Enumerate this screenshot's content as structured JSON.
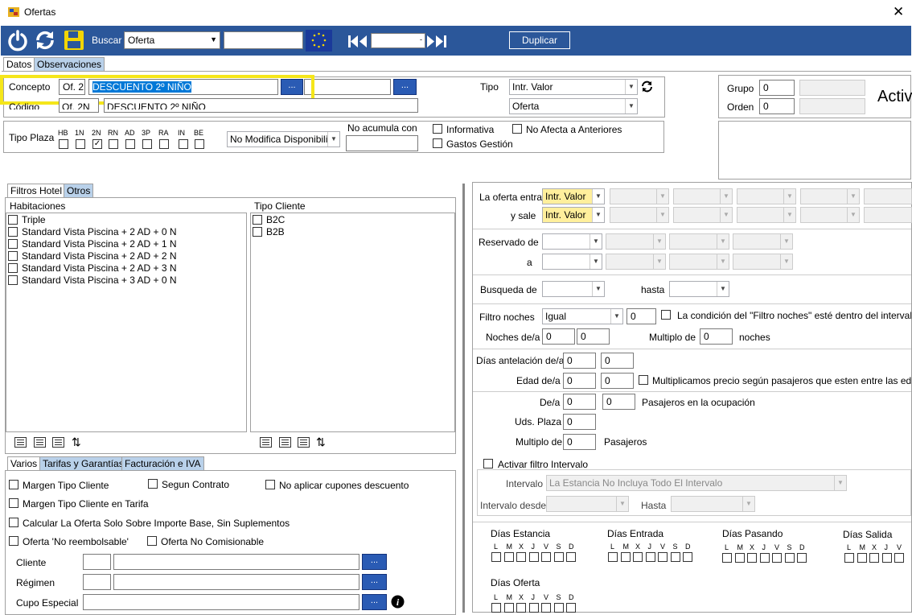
{
  "window": {
    "title": "Ofertas",
    "close": "✕"
  },
  "toolbar": {
    "buscar_label": "Buscar",
    "buscar_value": "Oferta",
    "duplicar": "Duplicar"
  },
  "tabs_main": [
    "Datos",
    "Observaciones"
  ],
  "concepto": {
    "label": "Concepto",
    "code": "Of. 2",
    "value": "DESCUENTO 2º NIÑO"
  },
  "codigo": {
    "label": "Código",
    "code": "Of. 2N",
    "value": "DESCUENTO 2º NIÑO"
  },
  "tipo": {
    "label": "Tipo",
    "value1": "Intr. Valor",
    "value2": "Oferta"
  },
  "grupo": {
    "label": "Grupo",
    "value": "0"
  },
  "orden": {
    "label": "Orden",
    "value": "0"
  },
  "activa_label": "Activ",
  "tipo_plaza": {
    "label": "Tipo Plaza",
    "codes": [
      "HB",
      "1N",
      "2N",
      "RN",
      "AD",
      "3P",
      "RA",
      "IN",
      "BE"
    ],
    "checked": [
      false,
      false,
      true,
      false,
      false,
      false,
      false,
      false,
      false
    ]
  },
  "modifica": "No Modifica Disponibilid",
  "no_acumula": "No acumula con",
  "informativa": "Informativa",
  "gastos": "Gastos Gestión",
  "no_afecta": "No Afecta a Anteriores",
  "filter_tabs": [
    "Filtros Hotel",
    "Otros"
  ],
  "habitaciones": {
    "header": "Habitaciones",
    "items": [
      "Triple",
      "Standard Vista Piscina + 2 AD + 0 N",
      "Standard Vista Piscina + 2 AD + 1 N",
      "Standard Vista Piscina + 2 AD + 2 N",
      "Standard Vista Piscina + 2 AD + 3 N",
      "Standard Vista Piscina + 3 AD + 0 N"
    ]
  },
  "tipo_cliente": {
    "header": "Tipo Cliente",
    "items": [
      "B2C",
      "B2B"
    ]
  },
  "bottom_tabs": [
    "Varios",
    "Tarifas y Garantías",
    "Facturación e IVA"
  ],
  "varios": {
    "margen_cliente": "Margen Tipo Cliente",
    "segun_contrato": "Segun Contrato",
    "no_cupones": "No aplicar cupones descuento",
    "margen_tarifa": "Margen Tipo Cliente  en Tarifa",
    "calcular": "Calcular La Oferta Solo Sobre Importe Base, Sin Suplementos",
    "no_reembolsable": "Oferta 'No reembolsable'",
    "no_comisionable": "Oferta No Comisionable",
    "cliente": "Cliente",
    "regimen": "Régimen",
    "cupo": "Cupo Especial",
    "dots": "..."
  },
  "right": {
    "oferta_entra": "La oferta entra",
    "y_sale": "y sale",
    "intr_valor": "Intr. Valor",
    "reservado_de": "Reservado de",
    "a": "a",
    "busqueda_de": "Busqueda de",
    "hasta": "hasta",
    "filtro_noches": "Filtro noches",
    "igual": "Igual",
    "zero": "0",
    "condicion": "La condición del \"Filtro noches\" esté dentro del intervalo de la",
    "noches_dea": "Noches de/a",
    "multiplo_de": "Multiplo de",
    "noches": "noches",
    "dias_antelacion": "Días antelación de/a",
    "edad_dea": "Edad de/a",
    "multiplicamos": "Multiplicamos precio según pasajeros que esten entre las edades ind",
    "dea": "De/a",
    "pasajeros_ocupacion": "Pasajeros en la ocupación",
    "uds_plaza": "Uds. Plaza",
    "multiplo_de2": "Multiplo de",
    "pasajeros": "Pasajeros",
    "activar_filtro": "Activar filtro Intervalo",
    "intervalo": "Intervalo",
    "intervalo_value": "La Estancia No Incluya Todo El Intervalo",
    "intervalo_desde": "Intervalo desde",
    "hasta2": "Hasta",
    "dias_estancia": "Días Estancia",
    "dias_entrada": "Días Entrada",
    "dias_pasando": "Días Pasando",
    "dias_salida": "Días Salida",
    "dias_oferta": "Días Oferta",
    "weekdays": [
      "L",
      "M",
      "X",
      "J",
      "V",
      "S",
      "D"
    ]
  }
}
